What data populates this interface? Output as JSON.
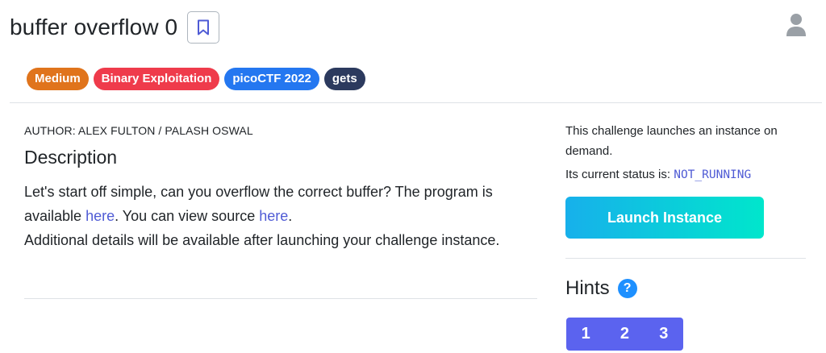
{
  "header": {
    "title": "buffer overflow 0"
  },
  "tags": [
    {
      "label": "Medium",
      "color": "#e0741c"
    },
    {
      "label": "Binary Exploitation",
      "color": "#ef3b4b"
    },
    {
      "label": "picoCTF 2022",
      "color": "#2477f0"
    },
    {
      "label": "gets",
      "color": "#2c3a5e"
    }
  ],
  "main": {
    "author": "AUTHOR: ALEX FULTON / PALASH OSWAL",
    "description_heading": "Description",
    "desc_part1": "Let's start off simple, can you overflow the correct buffer? The program is available ",
    "link1": "here",
    "desc_part2": ". You can view source ",
    "link2": "here",
    "desc_part3": ".",
    "desc_line2": "Additional details will be available after launching your challenge instance."
  },
  "side": {
    "instance_text": "This challenge launches an instance on demand.",
    "status_label": "Its current status is: ",
    "status_value": "NOT_RUNNING",
    "launch_button": "Launch Instance",
    "hints_title": "Hints",
    "help_symbol": "?",
    "hint_buttons": [
      "1",
      "2",
      "3"
    ]
  },
  "icons": {
    "bookmark": "bookmark-icon",
    "user": "user-icon",
    "help": "help-icon"
  }
}
